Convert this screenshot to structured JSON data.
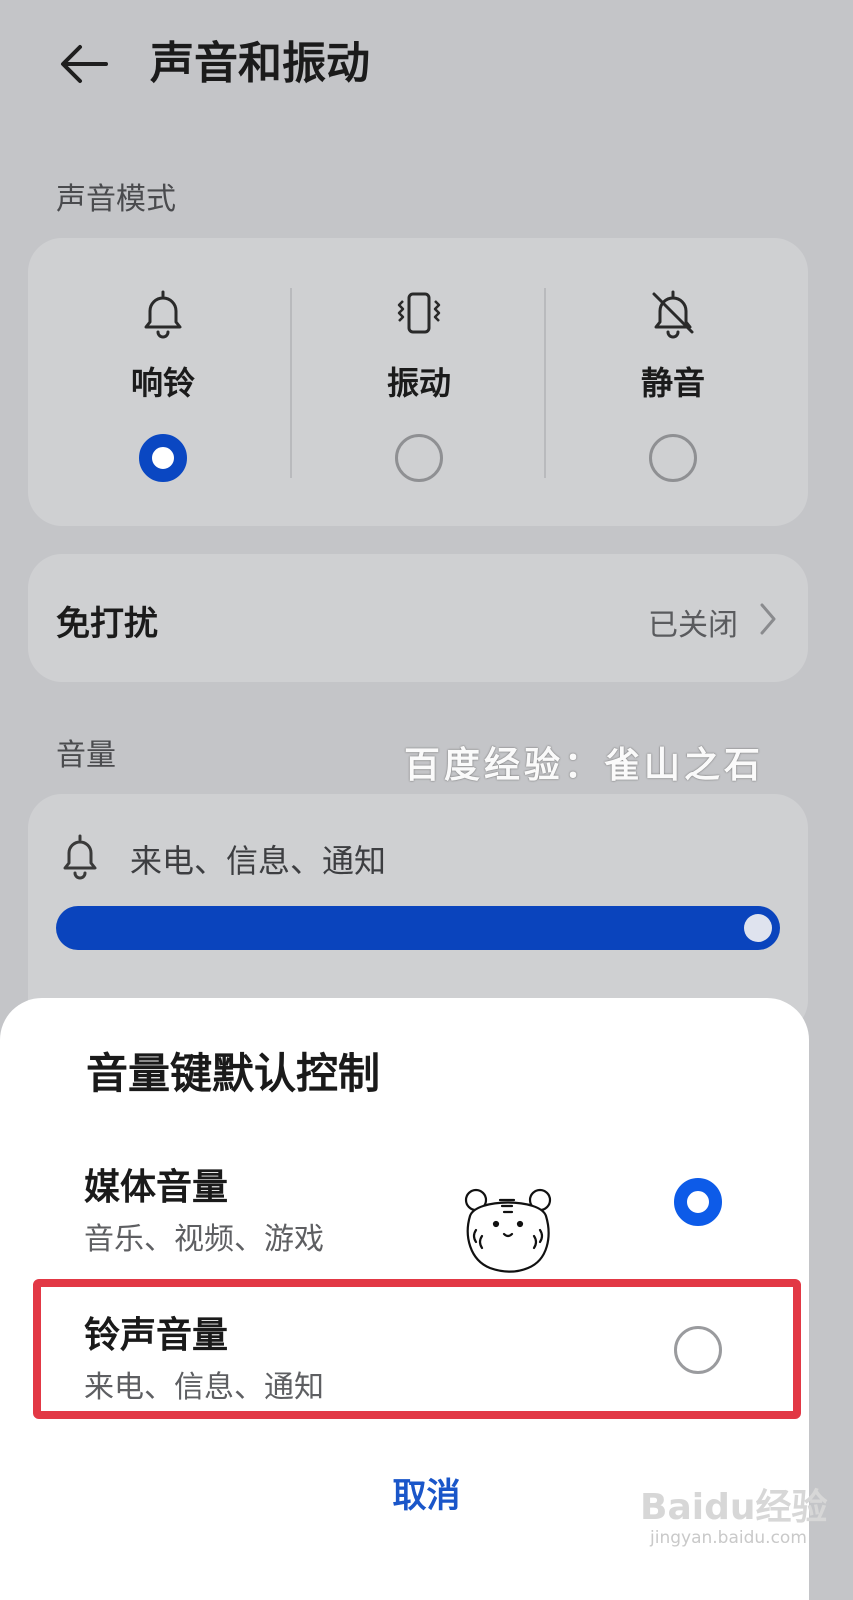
{
  "header": {
    "title": "声音和振动"
  },
  "sound_mode": {
    "section_label": "声音模式",
    "options": [
      {
        "label": "响铃",
        "icon": "bell-icon",
        "selected": true
      },
      {
        "label": "振动",
        "icon": "vibrate-icon",
        "selected": false
      },
      {
        "label": "静音",
        "icon": "bell-off-icon",
        "selected": false
      }
    ]
  },
  "dnd": {
    "label": "免打扰",
    "status": "已关闭"
  },
  "volume": {
    "section_label": "音量",
    "ring_label": "来电、信息、通知",
    "ring_level": 1.0,
    "accent_color": "#0a44bd"
  },
  "watermark": {
    "text": "百度经验：雀山之石"
  },
  "sheet": {
    "title": "音量键默认控制",
    "options": [
      {
        "title": "媒体音量",
        "subtitle": "音乐、视频、游戏",
        "selected": true
      },
      {
        "title": "铃声音量",
        "subtitle": "来电、信息、通知",
        "selected": false
      }
    ],
    "cancel_label": "取消"
  },
  "highlight_color": "#e23845",
  "baidu_watermark": {
    "logo": "Baidu经验",
    "url": "jingyan.baidu.com"
  }
}
